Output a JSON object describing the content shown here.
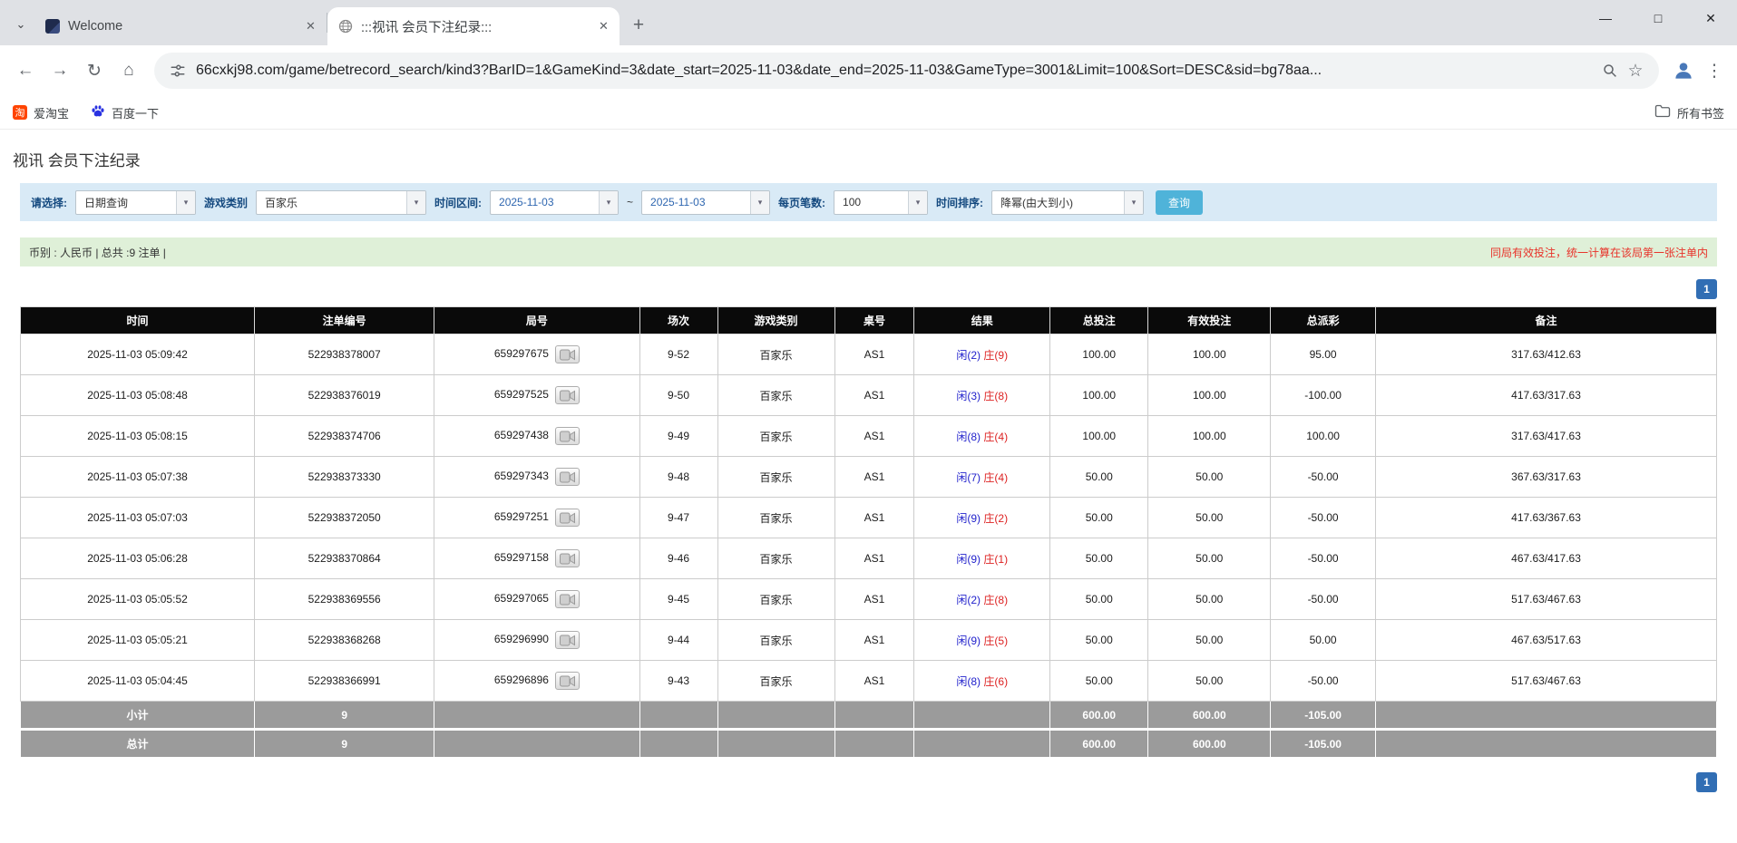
{
  "icons": {
    "tab_search": "⌄",
    "close_tab": "✕",
    "new_tab": "+",
    "minimize": "—",
    "maximize": "□",
    "close_window": "✕",
    "back": "←",
    "forward": "→",
    "reload": "↻",
    "home": "⌂",
    "star": "☆",
    "menu": "⋮",
    "dropdown": "▾",
    "taobao_glyph": "淘"
  },
  "browser": {
    "tabs": [
      {
        "label": "Welcome"
      },
      {
        "label": ":::视讯 会员下注纪录:::"
      }
    ],
    "url": "66cxkj98.com/game/betrecord_search/kind3?BarID=1&GameKind=3&date_start=2025-11-03&date_end=2025-11-03&GameType=3001&Limit=100&Sort=DESC&sid=bg78aa...",
    "bookmarks": [
      {
        "label": "爱淘宝"
      },
      {
        "label": "百度一下"
      }
    ],
    "all_bookmarks_label": "所有书签"
  },
  "page": {
    "title": "视讯 会员下注纪录",
    "filter": {
      "select_label": "请选择:",
      "select_value": "日期查询",
      "game_label": "游戏类别",
      "game_value": "百家乐",
      "range_label": "时间区间:",
      "date_start": "2025-11-03",
      "range_separator": "~",
      "date_end": "2025-11-03",
      "per_page_label": "每页笔数:",
      "per_page_value": "100",
      "sort_label": "时间排序:",
      "sort_value": "降幂(由大到小)",
      "search_button_label": "查询"
    },
    "info_bar": {
      "left": "币别 : 人民币 | 总共 :9 注单 |",
      "right": "同局有效投注，统一计算在该局第一张注单内"
    },
    "pagination": "1",
    "table": {
      "headers": [
        "时间",
        "注单编号",
        "局号",
        "场次",
        "游戏类别",
        "桌号",
        "结果",
        "总投注",
        "有效投注",
        "总派彩",
        "备注"
      ],
      "rows": [
        {
          "time": "2025-11-03 05:09:42",
          "bet_id": "522938378007",
          "round_id": "659297675",
          "session": "9-52",
          "game_type": "百家乐",
          "table_no": "AS1",
          "result_player": "闲(2)",
          "result_banker": "庄(9)",
          "total_bet": "100.00",
          "valid_bet": "100.00",
          "payout": "95.00",
          "note": "317.63/412.63"
        },
        {
          "time": "2025-11-03 05:08:48",
          "bet_id": "522938376019",
          "round_id": "659297525",
          "session": "9-50",
          "game_type": "百家乐",
          "table_no": "AS1",
          "result_player": "闲(3)",
          "result_banker": "庄(8)",
          "total_bet": "100.00",
          "valid_bet": "100.00",
          "payout": "-100.00",
          "note": "417.63/317.63"
        },
        {
          "time": "2025-11-03 05:08:15",
          "bet_id": "522938374706",
          "round_id": "659297438",
          "session": "9-49",
          "game_type": "百家乐",
          "table_no": "AS1",
          "result_player": "闲(8)",
          "result_banker": "庄(4)",
          "total_bet": "100.00",
          "valid_bet": "100.00",
          "payout": "100.00",
          "note": "317.63/417.63"
        },
        {
          "time": "2025-11-03 05:07:38",
          "bet_id": "522938373330",
          "round_id": "659297343",
          "session": "9-48",
          "game_type": "百家乐",
          "table_no": "AS1",
          "result_player": "闲(7)",
          "result_banker": "庄(4)",
          "total_bet": "50.00",
          "valid_bet": "50.00",
          "payout": "-50.00",
          "note": "367.63/317.63"
        },
        {
          "time": "2025-11-03 05:07:03",
          "bet_id": "522938372050",
          "round_id": "659297251",
          "session": "9-47",
          "game_type": "百家乐",
          "table_no": "AS1",
          "result_player": "闲(9)",
          "result_banker": "庄(2)",
          "total_bet": "50.00",
          "valid_bet": "50.00",
          "payout": "-50.00",
          "note": "417.63/367.63"
        },
        {
          "time": "2025-11-03 05:06:28",
          "bet_id": "522938370864",
          "round_id": "659297158",
          "session": "9-46",
          "game_type": "百家乐",
          "table_no": "AS1",
          "result_player": "闲(9)",
          "result_banker": "庄(1)",
          "total_bet": "50.00",
          "valid_bet": "50.00",
          "payout": "-50.00",
          "note": "467.63/417.63"
        },
        {
          "time": "2025-11-03 05:05:52",
          "bet_id": "522938369556",
          "round_id": "659297065",
          "session": "9-45",
          "game_type": "百家乐",
          "table_no": "AS1",
          "result_player": "闲(2)",
          "result_banker": "庄(8)",
          "total_bet": "50.00",
          "valid_bet": "50.00",
          "payout": "-50.00",
          "note": "517.63/467.63"
        },
        {
          "time": "2025-11-03 05:05:21",
          "bet_id": "522938368268",
          "round_id": "659296990",
          "session": "9-44",
          "game_type": "百家乐",
          "table_no": "AS1",
          "result_player": "闲(9)",
          "result_banker": "庄(5)",
          "total_bet": "50.00",
          "valid_bet": "50.00",
          "payout": "50.00",
          "note": "467.63/517.63"
        },
        {
          "time": "2025-11-03 05:04:45",
          "bet_id": "522938366991",
          "round_id": "659296896",
          "session": "9-43",
          "game_type": "百家乐",
          "table_no": "AS1",
          "result_player": "闲(8)",
          "result_banker": "庄(6)",
          "total_bet": "50.00",
          "valid_bet": "50.00",
          "payout": "-50.00",
          "note": "517.63/467.63"
        }
      ],
      "subtotal": {
        "label": "小计",
        "count": "9",
        "total_bet": "600.00",
        "valid_bet": "600.00",
        "payout": "-105.00"
      },
      "total": {
        "label": "总计",
        "count": "9",
        "total_bet": "600.00",
        "valid_bet": "600.00",
        "payout": "-105.00"
      }
    }
  }
}
